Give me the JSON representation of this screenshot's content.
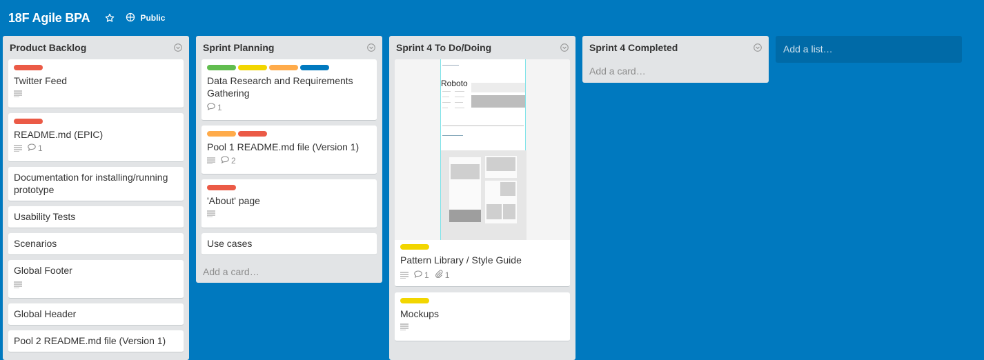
{
  "board": {
    "title": "18F Agile BPA",
    "visibility": "Public",
    "icons": {
      "star": "star-icon",
      "visibility": "globe-icon"
    },
    "background_color": "#0079bf"
  },
  "label_colors": {
    "red": "#eb5a46",
    "green": "#61bd4f",
    "yellow": "#f2d600",
    "orange": "#ffab4a",
    "blue": "#0079bf"
  },
  "lists": [
    {
      "title": "Product Backlog",
      "cards": [
        {
          "title": "Twitter Feed",
          "labels": [
            "red"
          ],
          "description": true
        },
        {
          "title": "README.md (EPIC)",
          "labels": [
            "red"
          ],
          "description": true,
          "comments": "1"
        },
        {
          "title": "Documentation for installing/running prototype"
        },
        {
          "title": "Usability Tests"
        },
        {
          "title": "Scenarios"
        },
        {
          "title": "Global Footer",
          "description": true
        },
        {
          "title": "Global Header"
        },
        {
          "title": "Pool 2 README.md file (Version 1)"
        }
      ]
    },
    {
      "title": "Sprint Planning",
      "cards": [
        {
          "title": "Data Research and Requirements Gathering",
          "labels": [
            "green",
            "yellow",
            "orange",
            "blue"
          ],
          "comments": "1"
        },
        {
          "title": "Pool 1 README.md file (Version 1)",
          "labels": [
            "orange",
            "red"
          ],
          "description": true,
          "comments": "2"
        },
        {
          "title": "'About' page",
          "labels": [
            "red"
          ],
          "description": true
        },
        {
          "title": "Use cases"
        }
      ],
      "add_card": "Add a card…"
    },
    {
      "title": "Sprint 4 To Do/Doing",
      "cards": [
        {
          "title": "Pattern Library / Style Guide",
          "labels": [
            "yellow"
          ],
          "description": true,
          "comments": "1",
          "attachments": "1",
          "cover_text": "Roboto"
        },
        {
          "title": "Mockups",
          "labels": [
            "yellow"
          ],
          "description": true
        }
      ]
    },
    {
      "title": "Sprint 4 Completed",
      "cards": [],
      "add_card": "Add a card…"
    }
  ],
  "add_list": "Add a list…"
}
